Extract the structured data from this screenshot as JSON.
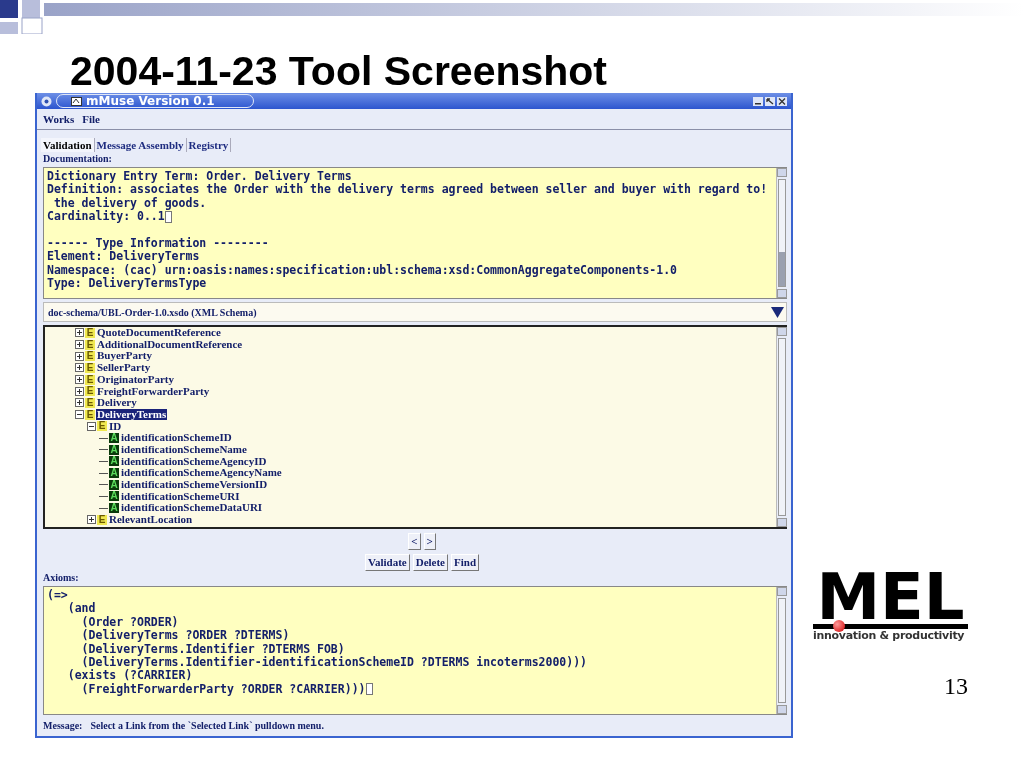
{
  "slide": {
    "title": "2004-11-23 Tool Screenshot",
    "page_number": "13"
  },
  "logo": {
    "mark": "MEL",
    "tagline": "innovation & productivity"
  },
  "window": {
    "title": "mMuse Version 0.1"
  },
  "menu": [
    "Works",
    "File"
  ],
  "tabs": [
    {
      "label": "Validation",
      "selected": true
    },
    {
      "label": "Message Assembly",
      "selected": false
    },
    {
      "label": "Registry",
      "selected": false
    }
  ],
  "documentation": {
    "label": "Documentation:",
    "blocks": [
      {
        "lines": [
          {
            "text": "Dictionary Entry Term: Order. Delivery Terms",
            "caret": false
          },
          {
            "text": "Definition: associates the Order with the delivery terms agreed between seller and buyer with regard to!",
            "caret": false
          },
          {
            "text": " the delivery of goods.",
            "caret": false
          },
          {
            "text": "Cardinality: 0..1",
            "caret": true
          }
        ]
      },
      {
        "lines": [
          {
            "text": "------ Type Information --------",
            "caret": false
          },
          {
            "text": "Element: DeliveryTerms",
            "caret": false
          },
          {
            "text": "Namespace: (cac) urn:oasis:names:specification:ubl:schema:xsd:CommonAggregateComponents-1.0",
            "caret": false
          },
          {
            "text": "Type: DeliveryTermsType",
            "caret": false
          }
        ]
      }
    ]
  },
  "schema_select": {
    "value": "doc-schema/UBL-Order-1.0.xsdo (XML Schema)"
  },
  "tree": {
    "items": [
      {
        "label": "QuoteDocumentReference",
        "kind": "element",
        "badge": "E",
        "expanded": false,
        "selected": false
      },
      {
        "label": "AdditionalDocumentReference",
        "kind": "element",
        "badge": "E",
        "expanded": false,
        "selected": false
      },
      {
        "label": "BuyerParty",
        "kind": "element",
        "badge": "E",
        "expanded": false,
        "selected": false
      },
      {
        "label": "SellerParty",
        "kind": "element",
        "badge": "E",
        "expanded": false,
        "selected": false
      },
      {
        "label": "OriginatorParty",
        "kind": "element",
        "badge": "E",
        "expanded": false,
        "selected": false
      },
      {
        "label": "FreightForwarderParty",
        "kind": "element",
        "badge": "E",
        "expanded": false,
        "selected": false
      },
      {
        "label": "Delivery",
        "kind": "element",
        "badge": "E",
        "expanded": false,
        "selected": false
      },
      {
        "label": "DeliveryTerms",
        "kind": "element",
        "badge": "E",
        "expanded": true,
        "selected": true,
        "children": [
          {
            "label": "ID",
            "kind": "element",
            "badge": "E",
            "expanded": true,
            "selected": false,
            "children": [
              {
                "label": "identificationSchemeID",
                "kind": "attribute",
                "badge": "A",
                "selected": false
              },
              {
                "label": "identificationSchemeName",
                "kind": "attribute",
                "badge": "A",
                "selected": false
              },
              {
                "label": "identificationSchemeAgencyID",
                "kind": "attribute",
                "badge": "A",
                "selected": false
              },
              {
                "label": "identificationSchemeAgencyName",
                "kind": "attribute",
                "badge": "A",
                "selected": false
              },
              {
                "label": "identificationSchemeVersionID",
                "kind": "attribute",
                "badge": "A",
                "selected": false
              },
              {
                "label": "identificationSchemeURI",
                "kind": "attribute",
                "badge": "A",
                "selected": false
              },
              {
                "label": "identificationSchemeDataURI",
                "kind": "attribute",
                "badge": "A",
                "selected": false
              }
            ]
          },
          {
            "label": "RelevantLocation",
            "kind": "element",
            "badge": "E",
            "expanded": false,
            "selected": false
          }
        ]
      }
    ]
  },
  "nav_buttons": [
    "<",
    ">"
  ],
  "actions": [
    "Validate",
    "Delete",
    "Find"
  ],
  "axioms": {
    "label": "Axioms:",
    "lines": [
      {
        "text": "(=>",
        "caret": false
      },
      {
        "text": "   (and",
        "caret": false
      },
      {
        "text": "     (Order ?ORDER)",
        "caret": false
      },
      {
        "text": "     (DeliveryTerms ?ORDER ?DTERMS)",
        "caret": false
      },
      {
        "text": "     (DeliveryTerms.Identifier ?DTERMS FOB)",
        "caret": false
      },
      {
        "text": "     (DeliveryTerms.Identifier-identificationSchemeID ?DTERMS incoterms2000)))",
        "caret": false
      },
      {
        "text": "   (exists (?CARRIER)",
        "caret": false
      },
      {
        "text": "     (FreightForwarderParty ?ORDER ?CARRIER)))",
        "caret": true
      }
    ]
  },
  "status": {
    "label": "Message:",
    "text": "Select a Link from the `Selected Link` pulldown menu."
  }
}
